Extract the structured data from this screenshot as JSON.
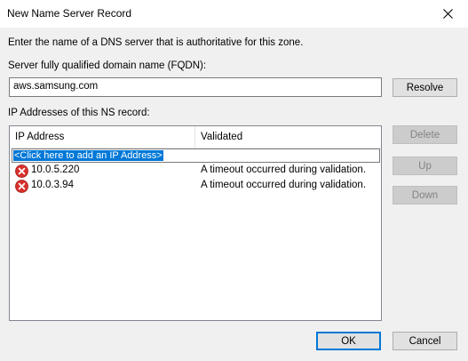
{
  "window": {
    "title": "New Name Server Record"
  },
  "dialog": {
    "intro_text": "Enter the name of a DNS server that is authoritative for this zone.",
    "fqdn_label": "Server fully qualified domain name (FQDN):",
    "fqdn_value": "aws.samsung.com",
    "resolve_label": "Resolve",
    "ip_section_label": "IP Addresses of this NS record:",
    "columns": [
      "IP Address",
      "Validated"
    ],
    "add_placeholder": "<Click here to add an IP Address>",
    "rows": [
      {
        "ip": "10.0.5.220",
        "status": "A timeout occurred during validation.",
        "icon": "error-icon"
      },
      {
        "ip": "10.0.3.94",
        "status": "A timeout occurred during validation.",
        "icon": "error-icon"
      }
    ],
    "side_buttons": {
      "delete_label": "Delete",
      "up_label": "Up",
      "down_label": "Down"
    },
    "ok_label": "OK",
    "cancel_label": "Cancel"
  },
  "colors": {
    "accent": "#0078d7",
    "error": "#d9302c"
  }
}
